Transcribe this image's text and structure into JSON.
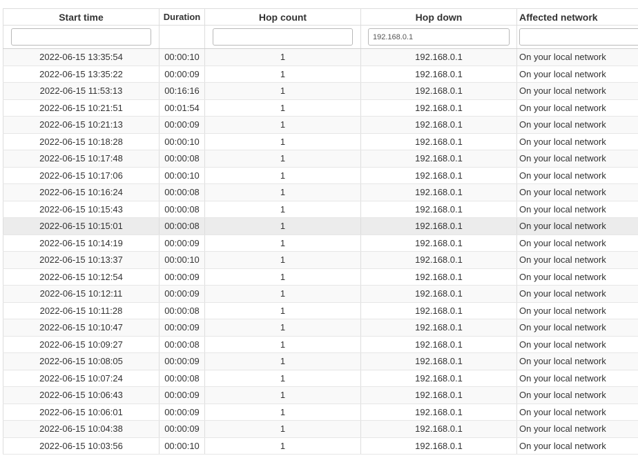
{
  "columns": {
    "start_time": "Start time",
    "duration": "Duration",
    "hop_count": "Hop count",
    "hop_down": "Hop down",
    "affected_network": "Affected network"
  },
  "filters": {
    "start_time": "",
    "duration": null,
    "hop_count": "",
    "hop_down": "192.168.0.1",
    "affected_network": ""
  },
  "hovered_row": 10,
  "rows": [
    {
      "start_time": "2022-06-15 13:35:54",
      "duration": "00:00:10",
      "hop_count": "1",
      "hop_down": "192.168.0.1",
      "affected_network": "On your local network"
    },
    {
      "start_time": "2022-06-15 13:35:22",
      "duration": "00:00:09",
      "hop_count": "1",
      "hop_down": "192.168.0.1",
      "affected_network": "On your local network"
    },
    {
      "start_time": "2022-06-15 11:53:13",
      "duration": "00:16:16",
      "hop_count": "1",
      "hop_down": "192.168.0.1",
      "affected_network": "On your local network"
    },
    {
      "start_time": "2022-06-15 10:21:51",
      "duration": "00:01:54",
      "hop_count": "1",
      "hop_down": "192.168.0.1",
      "affected_network": "On your local network"
    },
    {
      "start_time": "2022-06-15 10:21:13",
      "duration": "00:00:09",
      "hop_count": "1",
      "hop_down": "192.168.0.1",
      "affected_network": "On your local network"
    },
    {
      "start_time": "2022-06-15 10:18:28",
      "duration": "00:00:10",
      "hop_count": "1",
      "hop_down": "192.168.0.1",
      "affected_network": "On your local network"
    },
    {
      "start_time": "2022-06-15 10:17:48",
      "duration": "00:00:08",
      "hop_count": "1",
      "hop_down": "192.168.0.1",
      "affected_network": "On your local network"
    },
    {
      "start_time": "2022-06-15 10:17:06",
      "duration": "00:00:10",
      "hop_count": "1",
      "hop_down": "192.168.0.1",
      "affected_network": "On your local network"
    },
    {
      "start_time": "2022-06-15 10:16:24",
      "duration": "00:00:08",
      "hop_count": "1",
      "hop_down": "192.168.0.1",
      "affected_network": "On your local network"
    },
    {
      "start_time": "2022-06-15 10:15:43",
      "duration": "00:00:08",
      "hop_count": "1",
      "hop_down": "192.168.0.1",
      "affected_network": "On your local network"
    },
    {
      "start_time": "2022-06-15 10:15:01",
      "duration": "00:00:08",
      "hop_count": "1",
      "hop_down": "192.168.0.1",
      "affected_network": "On your local network"
    },
    {
      "start_time": "2022-06-15 10:14:19",
      "duration": "00:00:09",
      "hop_count": "1",
      "hop_down": "192.168.0.1",
      "affected_network": "On your local network"
    },
    {
      "start_time": "2022-06-15 10:13:37",
      "duration": "00:00:10",
      "hop_count": "1",
      "hop_down": "192.168.0.1",
      "affected_network": "On your local network"
    },
    {
      "start_time": "2022-06-15 10:12:54",
      "duration": "00:00:09",
      "hop_count": "1",
      "hop_down": "192.168.0.1",
      "affected_network": "On your local network"
    },
    {
      "start_time": "2022-06-15 10:12:11",
      "duration": "00:00:09",
      "hop_count": "1",
      "hop_down": "192.168.0.1",
      "affected_network": "On your local network"
    },
    {
      "start_time": "2022-06-15 10:11:28",
      "duration": "00:00:08",
      "hop_count": "1",
      "hop_down": "192.168.0.1",
      "affected_network": "On your local network"
    },
    {
      "start_time": "2022-06-15 10:10:47",
      "duration": "00:00:09",
      "hop_count": "1",
      "hop_down": "192.168.0.1",
      "affected_network": "On your local network"
    },
    {
      "start_time": "2022-06-15 10:09:27",
      "duration": "00:00:08",
      "hop_count": "1",
      "hop_down": "192.168.0.1",
      "affected_network": "On your local network"
    },
    {
      "start_time": "2022-06-15 10:08:05",
      "duration": "00:00:09",
      "hop_count": "1",
      "hop_down": "192.168.0.1",
      "affected_network": "On your local network"
    },
    {
      "start_time": "2022-06-15 10:07:24",
      "duration": "00:00:08",
      "hop_count": "1",
      "hop_down": "192.168.0.1",
      "affected_network": "On your local network"
    },
    {
      "start_time": "2022-06-15 10:06:43",
      "duration": "00:00:09",
      "hop_count": "1",
      "hop_down": "192.168.0.1",
      "affected_network": "On your local network"
    },
    {
      "start_time": "2022-06-15 10:06:01",
      "duration": "00:00:09",
      "hop_count": "1",
      "hop_down": "192.168.0.1",
      "affected_network": "On your local network"
    },
    {
      "start_time": "2022-06-15 10:04:38",
      "duration": "00:00:09",
      "hop_count": "1",
      "hop_down": "192.168.0.1",
      "affected_network": "On your local network"
    },
    {
      "start_time": "2022-06-15 10:03:56",
      "duration": "00:00:10",
      "hop_count": "1",
      "hop_down": "192.168.0.1",
      "affected_network": "On your local network"
    }
  ]
}
